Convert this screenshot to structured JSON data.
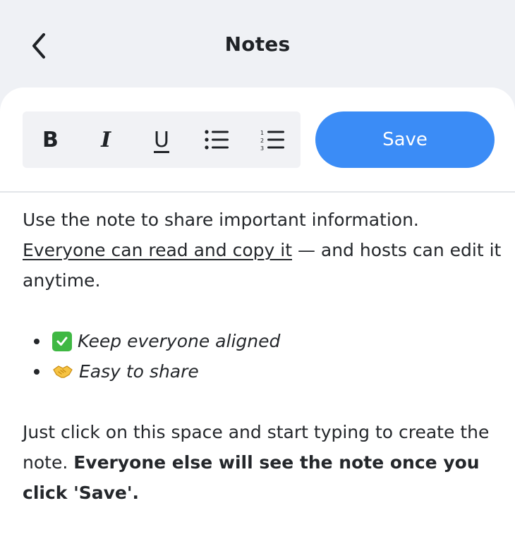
{
  "header": {
    "title": "Notes",
    "back_icon": "chevron-left-icon"
  },
  "toolbar": {
    "bold_label": "B",
    "italic_label": "I",
    "underline_label": "U",
    "bullet_list_icon": "bullet-list-icon",
    "numbered_list_icon": "numbered-list-icon",
    "save_label": "Save"
  },
  "note": {
    "para1_line1": "Use the note to share important information.",
    "para1_link": "Everyone can read and copy it",
    "para1_rest": " — and hosts can edit it anytime.",
    "bullets": [
      {
        "icon": "check-mark-emoji",
        "text": "Keep everyone aligned"
      },
      {
        "icon": "handshake-emoji",
        "text": "Easy to share"
      }
    ],
    "para2_text": "Just click on this space and start typing to create the note. ",
    "para2_bold": "Everyone else will see the note once you click 'Save'."
  },
  "colors": {
    "background": "#eff1f5",
    "accent": "#3b8cf6",
    "toolbar_bg": "#f1f2f5"
  }
}
